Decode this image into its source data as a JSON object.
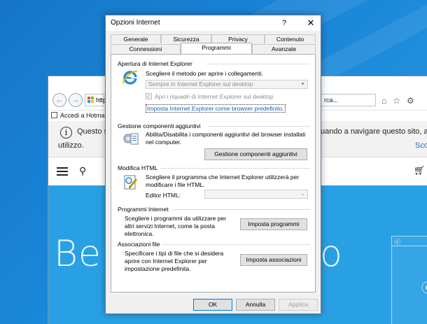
{
  "background_ie": {
    "address_text": "http",
    "address_right_text": "rca...",
    "tool_icons": [
      "home-icon",
      "star-icon",
      "gear-icon"
    ],
    "favorites_item": "Accedi a Hotma",
    "notice": {
      "left_line1": "Questo sit",
      "right_line1": "uando a navigare questo sito, acce",
      "line2": "utilizzo.",
      "link": "Scop"
    },
    "hero_left": "Ben",
    "hero_right": "o"
  },
  "dialog": {
    "title": "Opzioni Internet",
    "help_label": "?",
    "close_label": "✕",
    "tabs_back": [
      "Generale",
      "Sicurezza",
      "Privacy",
      "Contenuto"
    ],
    "tabs_front": [
      "Connessioni",
      "Programmi",
      "Avanzate"
    ],
    "active_tab": "Programmi",
    "open_ie": {
      "title": "Apertura di Internet Explorer",
      "desc": "Scegliere il metodo per aprire i collegamenti.",
      "select_value": "Sempre in Internet Explorer sul desktop",
      "checkbox_label": "Apri i riquadri di Internet Explorer sul desktop",
      "checkbox_checked": true,
      "link": "Imposta Internet Explorer come browser predefinito."
    },
    "addons": {
      "title": "Gestione componenti aggiuntivi",
      "desc_line1": "Abilita/Disabilita i componenti aggiuntivi del browser installati",
      "desc_line2": "nel computer.",
      "button": "Gestione componenti aggiuntivi"
    },
    "html_edit": {
      "title": "Modifica HTML",
      "desc_line1": "Scegliere il programma che Internet Explorer utilizzerà per",
      "desc_line2": "modificare i file HTML.",
      "editor_label": "Editor HTML:",
      "editor_value": ""
    },
    "internet_programs": {
      "title": "Programmi Internet",
      "desc_line1": "Scegliere i programmi da utilizzare per",
      "desc_line2": "altri servizi Internet, come la posta",
      "desc_line3": "elettronica.",
      "button": "Imposta programmi"
    },
    "file_assoc": {
      "title": "Associazioni file",
      "desc_line1": "Specificare i tipi di file che si desidera",
      "desc_line2": "aprire con Internet Explorer per",
      "desc_line3": "impostazione predefinita.",
      "button": "Imposta associazioni"
    },
    "footer": {
      "ok": "OK",
      "cancel": "Annulla",
      "apply": "Applica"
    }
  },
  "colors": {
    "desktop": "#1a86d8",
    "dialog_bg": "#f0f0f0",
    "link": "#1a5fb4",
    "ie_blue": "#1e90d8"
  }
}
